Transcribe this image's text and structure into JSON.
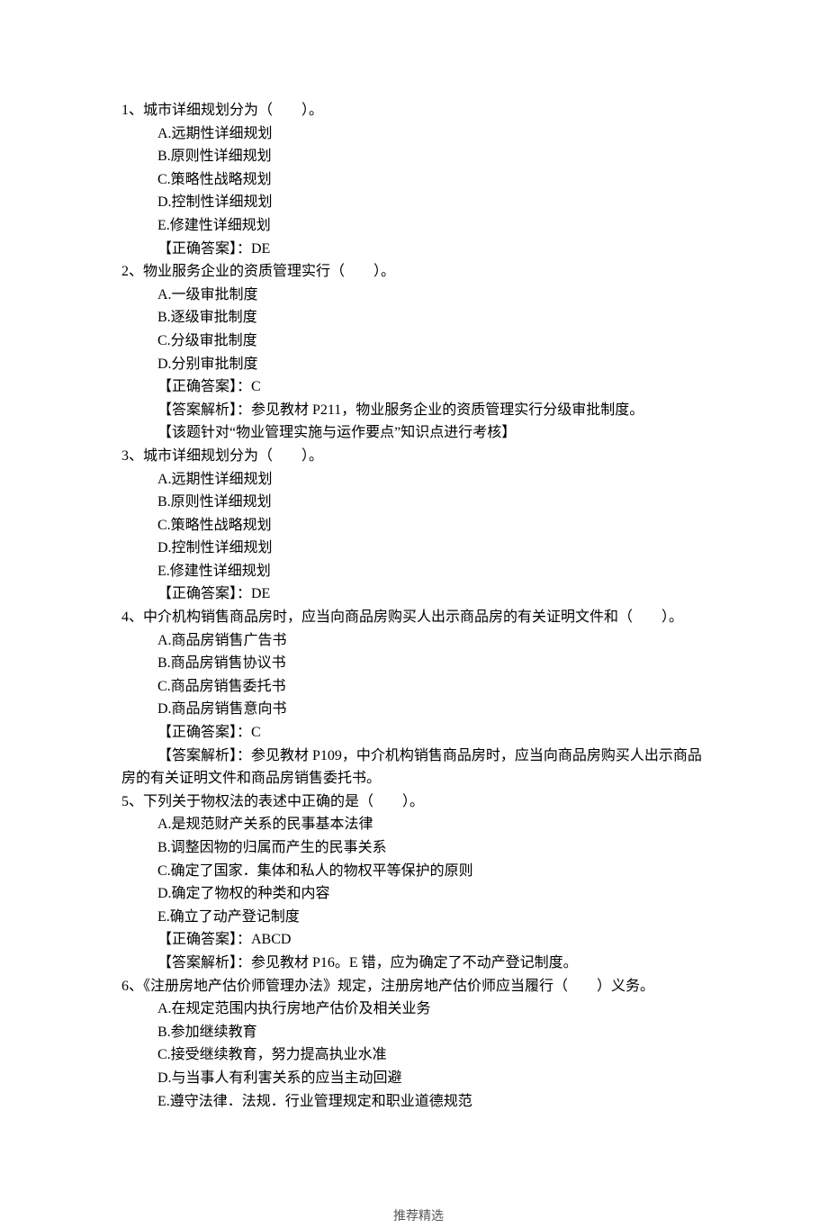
{
  "footer": "推荐精选",
  "questions": [
    {
      "num": "1",
      "stem": "城市详细规划分为（　　）。",
      "options": [
        "A.远期性详细规划",
        "B.原则性详细规划",
        "C.策略性战略规划",
        "D.控制性详细规划",
        "E.修建性详细规划"
      ],
      "answer": "【正确答案】：DE"
    },
    {
      "num": "2",
      "stem": "物业服务企业的资质管理实行（　　）。",
      "options": [
        "A.一级审批制度",
        "B.逐级审批制度",
        "C.分级审批制度",
        "D.分别审批制度"
      ],
      "answer": "【正确答案】：C",
      "explain": [
        "【答案解析】：参见教材 P211，物业服务企业的资质管理实行分级审批制度。",
        "【该题针对“物业管理实施与运作要点”知识点进行考核】"
      ]
    },
    {
      "num": "3",
      "stem": "城市详细规划分为（　　）。",
      "options": [
        "A.远期性详细规划",
        "B.原则性详细规划",
        "C.策略性战略规划",
        "D.控制性详细规划",
        "E.修建性详细规划"
      ],
      "answer": "【正确答案】：DE"
    },
    {
      "num": "4",
      "stem": "中介机构销售商品房时，应当向商品房购买人出示商品房的有关证明文件和（　　）。",
      "options": [
        "A.商品房销售广告书",
        "B.商品房销售协议书",
        "C.商品房销售委托书",
        "D.商品房销售意向书"
      ],
      "answer": "【正确答案】：C",
      "explainHang": "　　　【答案解析】：参见教材 P109，中介机构销售商品房时，应当向商品房购买人出示商品房的有关证明文件和商品房销售委托书。"
    },
    {
      "num": "5",
      "stem": "下列关于物权法的表述中正确的是（　　）。",
      "options": [
        "A.是规范财产关系的民事基本法律",
        "B.调整因物的归属而产生的民事关系",
        "C.确定了国家．集体和私人的物权平等保护的原则",
        "D.确定了物权的种类和内容",
        "E.确立了动产登记制度"
      ],
      "answer": "【正确答案】：ABCD",
      "explain": [
        "【答案解析】：参见教材 P16。E 错，应为确定了不动产登记制度。"
      ]
    },
    {
      "num": "6",
      "stem": "《注册房地产估价师管理办法》规定，注册房地产估价师应当履行（　　）义务。",
      "options": [
        "A.在规定范围内执行房地产估价及相关业务",
        "B.参加继续教育",
        "C.接受继续教育，努力提高执业水准",
        "D.与当事人有利害关系的应当主动回避",
        "E.遵守法律．法规．行业管理规定和职业道德规范"
      ]
    }
  ]
}
